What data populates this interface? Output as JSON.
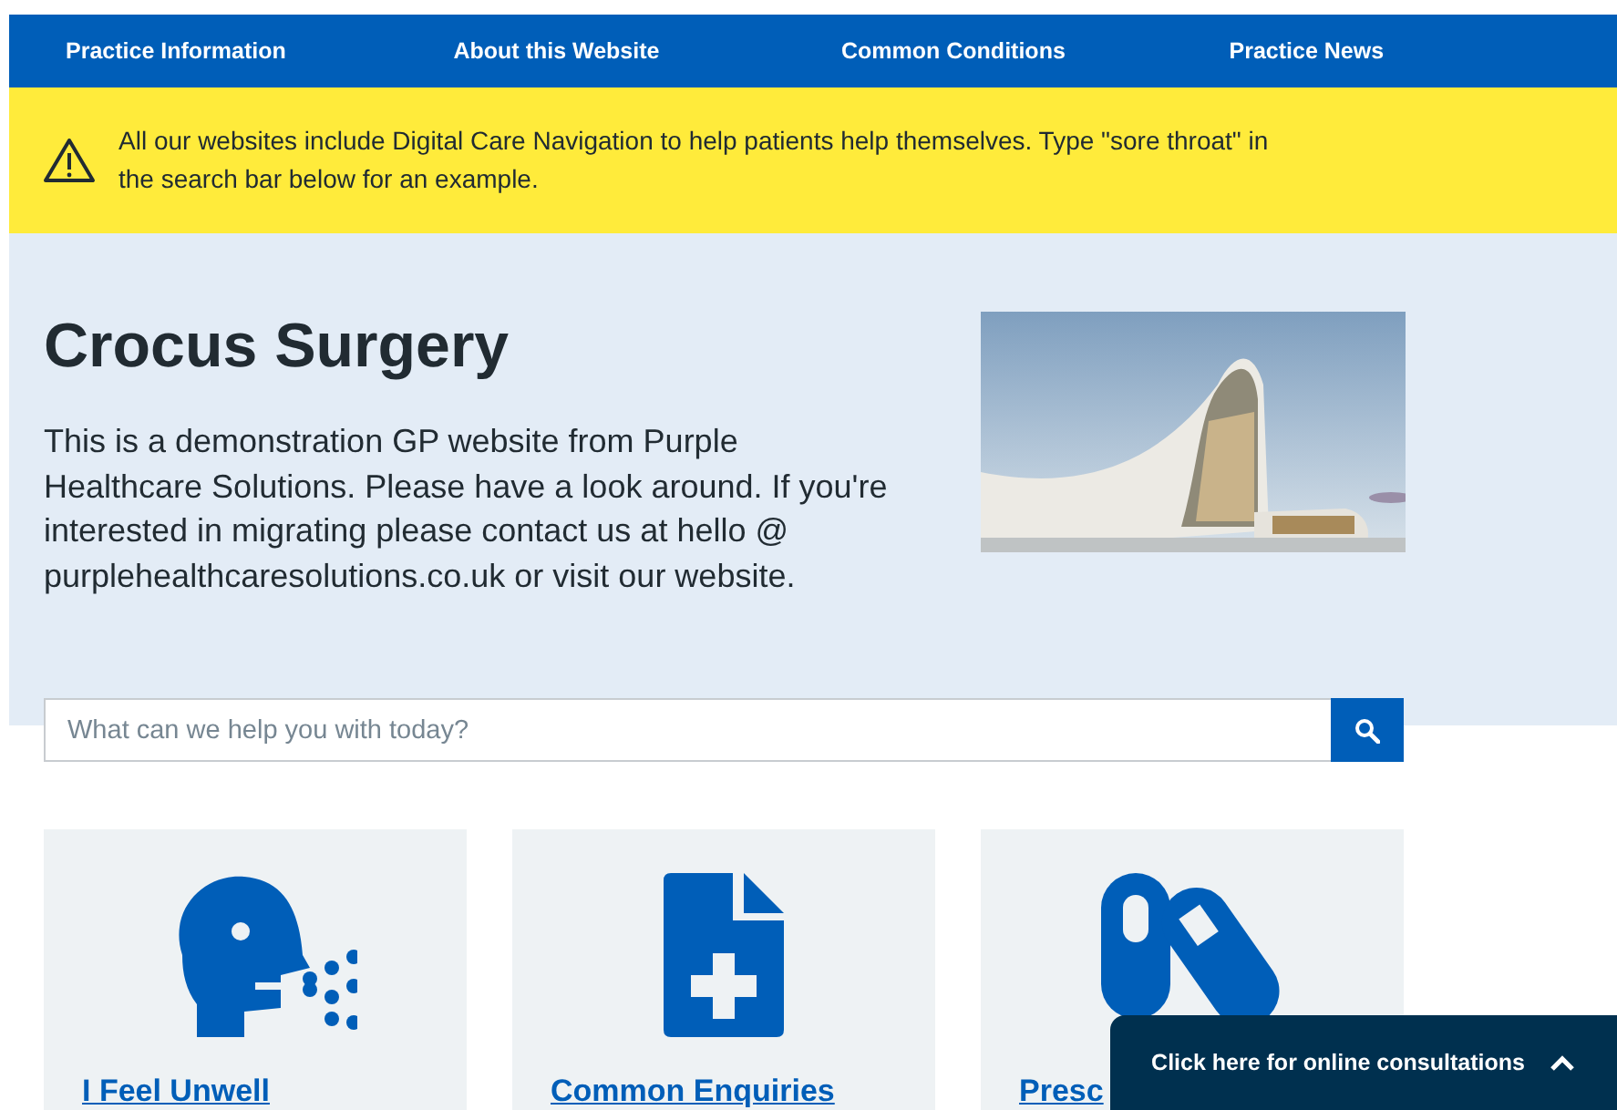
{
  "nav": {
    "items": [
      "Practice Information",
      "About this Website",
      "Common Conditions",
      "Practice News"
    ]
  },
  "notice": {
    "text": "All our websites include Digital Care Navigation to help patients help themselves.  Type \"sore throat\" in the search bar below for an example."
  },
  "hero": {
    "title": "Crocus Surgery",
    "text": "This is a demonstration GP website from Purple Healthcare Solutions. Please have a look around. If you're interested in migrating please contact us at hello @ purplehealthcaresolutions.co.uk or visit our website."
  },
  "search": {
    "placeholder": "What can we help you with today?"
  },
  "cards": [
    {
      "kind": "unwell",
      "label": "I Feel Unwell"
    },
    {
      "kind": "document",
      "label": "Common Enquiries"
    },
    {
      "kind": "pills",
      "label": "Presc"
    }
  ],
  "consult_bar": {
    "label": "Click here for online consultations"
  }
}
